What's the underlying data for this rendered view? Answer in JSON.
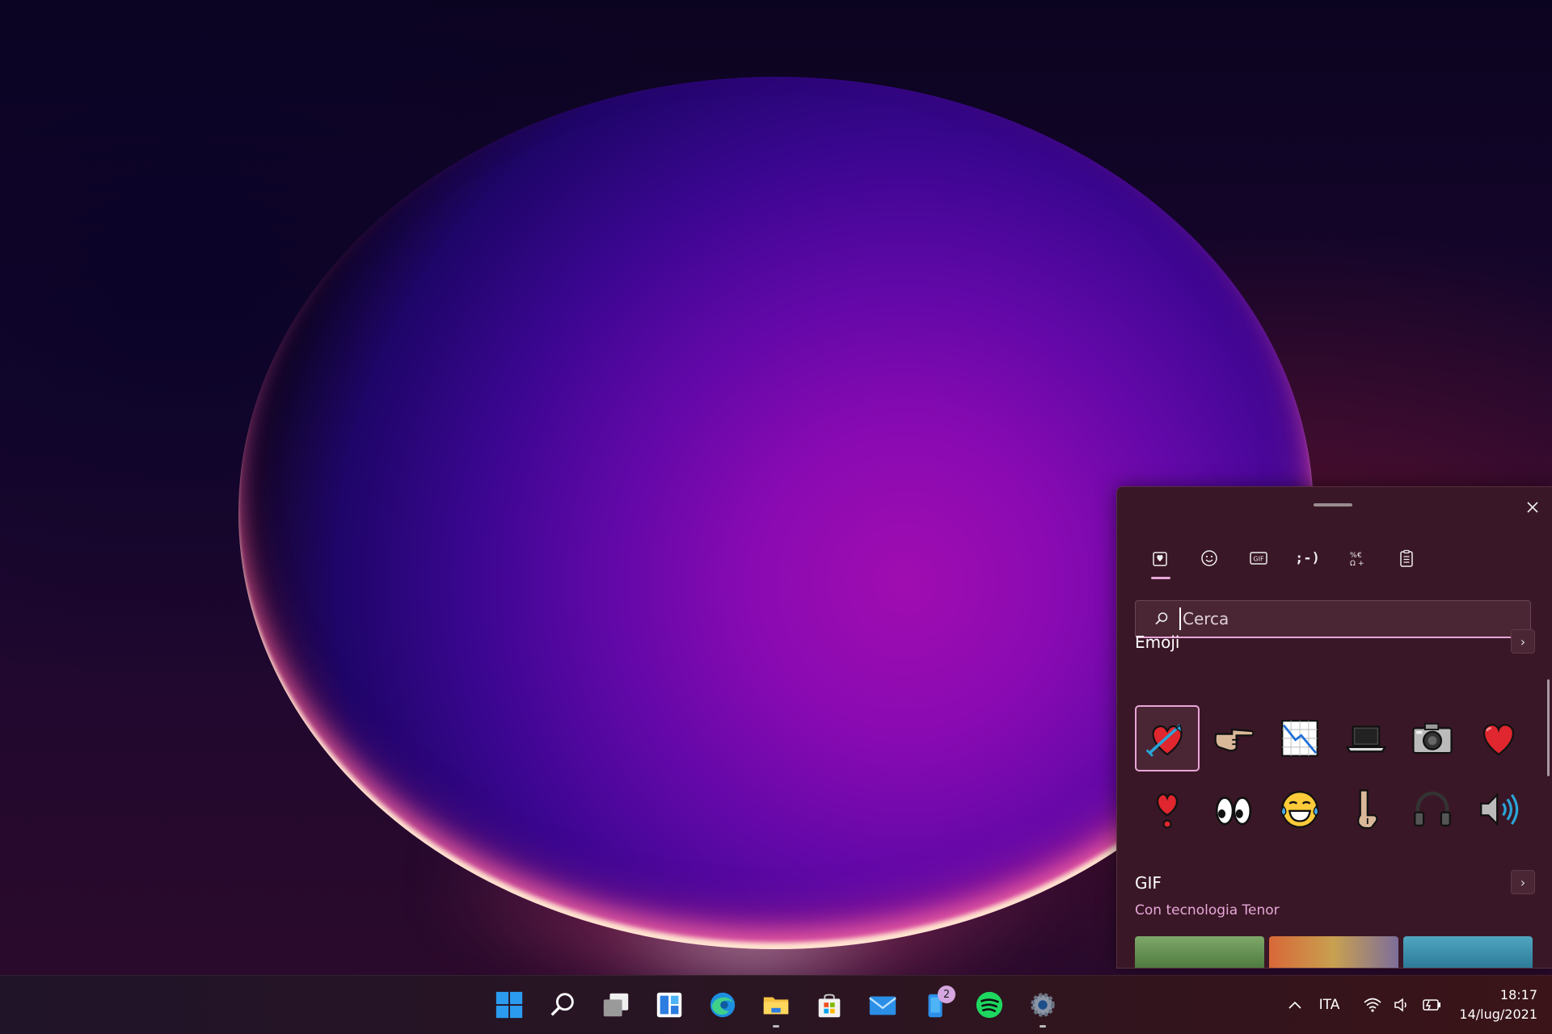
{
  "emoji_panel": {
    "tabs": [
      {
        "name": "recent",
        "icon": "heart-clipboard-icon",
        "active": true
      },
      {
        "name": "emoji",
        "icon": "smiley-icon"
      },
      {
        "name": "gif",
        "icon": "gif-icon",
        "label": "GIF"
      },
      {
        "name": "kaomoji",
        "icon": "kaomoji-icon",
        "label": ";-)"
      },
      {
        "name": "symbols",
        "icon": "symbols-icon"
      },
      {
        "name": "clipboard",
        "icon": "clipboard-icon"
      }
    ],
    "search": {
      "placeholder": "Cerca",
      "value": ""
    },
    "emoji_section": {
      "title": "Emoji",
      "items": [
        "💘",
        "👉",
        "📉",
        "💻",
        "📷",
        "❤️",
        "❣️",
        "👀",
        "😂",
        "👇",
        "🎧",
        "🔊"
      ]
    },
    "gif_section": {
      "title": "GIF",
      "subtitle": "Con tecnologia Tenor"
    }
  },
  "taskbar": {
    "apps": [
      {
        "name": "start",
        "icon": "windows-icon"
      },
      {
        "name": "search",
        "icon": "search-icon"
      },
      {
        "name": "task-view",
        "icon": "task-view-icon"
      },
      {
        "name": "widgets",
        "icon": "widgets-icon"
      },
      {
        "name": "edge",
        "icon": "edge-icon"
      },
      {
        "name": "file-explorer",
        "icon": "folder-icon",
        "running": true
      },
      {
        "name": "store",
        "icon": "store-icon"
      },
      {
        "name": "mail",
        "icon": "mail-icon"
      },
      {
        "name": "phone",
        "icon": "phone-icon",
        "badge": "2"
      },
      {
        "name": "spotify",
        "icon": "spotify-icon"
      },
      {
        "name": "settings",
        "icon": "gear-icon",
        "running": true
      }
    ],
    "tray": {
      "language": "ITA",
      "time": "18:17",
      "date": "14/lug/2021"
    }
  },
  "colors": {
    "accent": "#e8a6d8",
    "panel_bg": "#3a1726"
  }
}
